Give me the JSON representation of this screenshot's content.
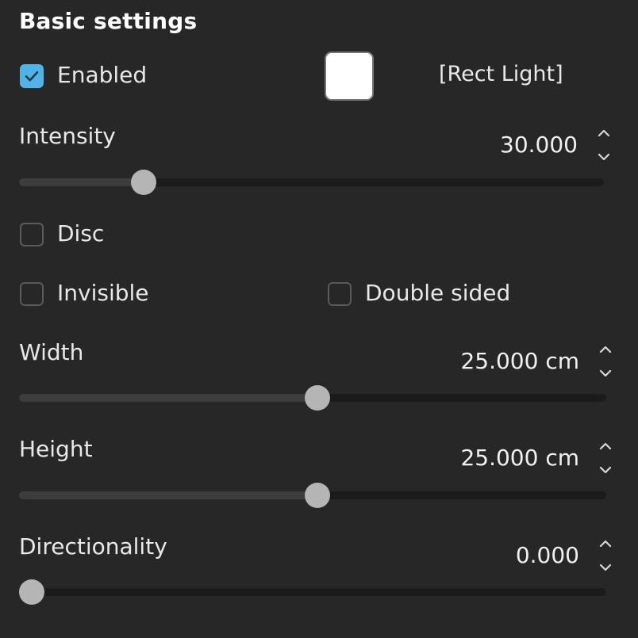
{
  "section": {
    "title": "Basic settings"
  },
  "enabled": {
    "label": "Enabled",
    "checked": true
  },
  "color_swatch": {
    "color": "#ffffff"
  },
  "light_type": "[Rect Light]",
  "intensity": {
    "label": "Intensity",
    "value": "30.000",
    "fraction": 0.213
  },
  "disc": {
    "label": "Disc",
    "checked": false
  },
  "invisible": {
    "label": "Invisible",
    "checked": false
  },
  "double_sided": {
    "label": "Double sided",
    "checked": false
  },
  "width": {
    "label": "Width",
    "value": "25.000 cm",
    "fraction": 0.508
  },
  "height": {
    "label": "Height",
    "value": "25.000 cm",
    "fraction": 0.508
  },
  "directionality": {
    "label": "Directionality",
    "value": "0.000",
    "fraction": 0.0
  },
  "colors": {
    "accent": "#4fb3e8",
    "background": "#272727",
    "thumb": "#b5b5b5"
  }
}
